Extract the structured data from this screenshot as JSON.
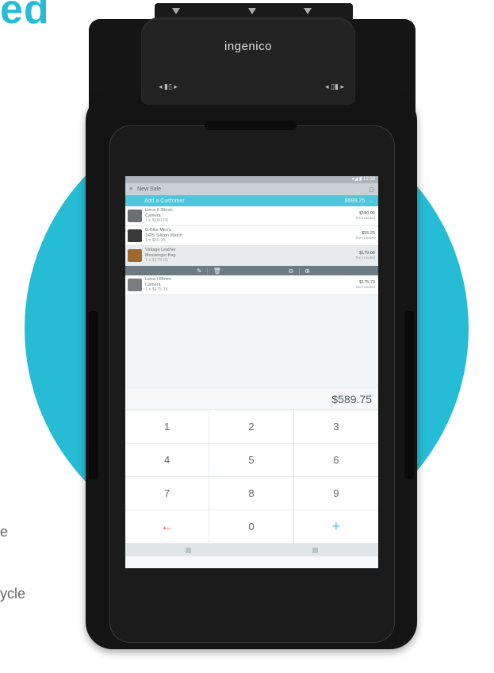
{
  "page": {
    "heading_fragment": "ed",
    "side_text_top": "e",
    "side_text_bottom": "ycle"
  },
  "device": {
    "brand": "ingenico",
    "top_indicators": [
      "▼",
      "▼",
      "▼"
    ],
    "card_indicator_left": "◂ ▮▯ ▸",
    "card_indicator_right": "◂ ▯▮ ▸"
  },
  "screen": {
    "status_bar": "▾◢ ▮ 12:30",
    "app_bar": {
      "menu_icon": "≡",
      "title": "New Sale",
      "chat_icon": "▢"
    },
    "customer_bar": {
      "customer_label": "Add a Customer",
      "total": "$589.75",
      "arrow": "→"
    },
    "cart_items": [
      {
        "name": "Leica II 35mm",
        "name2": "Camera",
        "meta": "1 x $180.00",
        "price": "$180.00",
        "tax": "Tax included",
        "thumb_color": "#6c6f70",
        "selected": false
      },
      {
        "name": "G-Bike Men's",
        "name2": "1425 Silicon Watch",
        "meta": "1 x $55.25",
        "price": "$55.25",
        "tax": "Tax included",
        "thumb_color": "#3a3a3a",
        "selected": false
      },
      {
        "name": "Vintage Leather",
        "name2": "Messenger Bag",
        "meta": "1 x $179.00",
        "price": "$179.00",
        "tax": "Tax included",
        "thumb_color": "#a0682e",
        "selected": true
      },
      {
        "name": "Leica I 65mm",
        "name2": "Camera",
        "meta": "1 x $175.75",
        "price": "$175.70",
        "tax": "Tax included",
        "thumb_color": "#7a7d7e",
        "selected": false
      }
    ],
    "action_bar": {
      "edit_icon": "✎",
      "delete_icon": "🗑",
      "minus_icon": "⊖",
      "plus_icon": "⊕"
    },
    "total_display": "$589.75",
    "keypad": [
      "1",
      "2",
      "3",
      "4",
      "5",
      "6",
      "7",
      "8",
      "9",
      "←",
      "0",
      "+"
    ]
  },
  "colors": {
    "accent": "#27bcd6",
    "customer_bar": "#4fc6db",
    "backspace": "#e74c3c"
  }
}
